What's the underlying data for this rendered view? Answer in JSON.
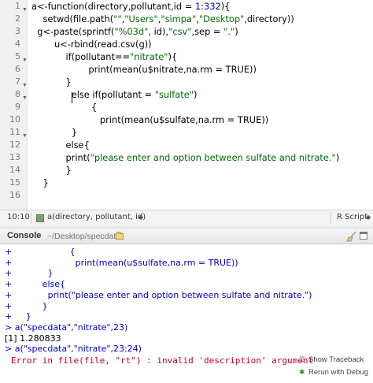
{
  "editor": {
    "line_numbers": [
      "1",
      "2",
      "3",
      "4",
      "5",
      "6",
      "7",
      "8",
      "9",
      "10",
      "11",
      "12",
      "13",
      "14",
      "15",
      "16"
    ],
    "lines": [
      [
        {
          "t": "a<-function(directory,pollutant,id = "
        },
        {
          "t": "1",
          "c": "num"
        },
        {
          "t": ":"
        },
        {
          "t": "332",
          "c": "num"
        },
        {
          "t": "){"
        }
      ],
      [
        {
          "t": "    setwd(file.path("
        },
        {
          "t": "\"\"",
          "c": "str"
        },
        {
          "t": ","
        },
        {
          "t": "\"Users\"",
          "c": "str"
        },
        {
          "t": ","
        },
        {
          "t": "\"simpa\"",
          "c": "str"
        },
        {
          "t": ","
        },
        {
          "t": "\"Desktop\"",
          "c": "str"
        },
        {
          "t": ",directory))"
        }
      ],
      [
        {
          "t": "  g<-paste(sprintf("
        },
        {
          "t": "\"%03d\"",
          "c": "str"
        },
        {
          "t": ", id),"
        },
        {
          "t": "\"csv\"",
          "c": "str"
        },
        {
          "t": ",sep = "
        },
        {
          "t": "\".\"",
          "c": "str"
        },
        {
          "t": ")"
        }
      ],
      [
        {
          "t": "        u<-rbind(read.csv(g))"
        }
      ],
      [
        {
          "t": "            if(pollutant=="
        },
        {
          "t": "\"nitrate\"",
          "c": "str"
        },
        {
          "t": "){"
        }
      ],
      [
        {
          "t": "                    print(mean(u$nitrate,na.rm = TRUE))"
        }
      ],
      [
        {
          "t": "            }"
        }
      ],
      [
        {
          "t": "              else if(pollutant = "
        },
        {
          "t": "\"sulfate\"",
          "c": "str"
        },
        {
          "t": ")"
        }
      ],
      [
        {
          "t": "                     {"
        }
      ],
      [
        {
          "t": "                        print(mean(u$sulfate,na.rm = TRUE))"
        }
      ],
      [
        {
          "t": "              }"
        }
      ],
      [
        {
          "t": "            else{"
        }
      ],
      [
        {
          "t": "            print("
        },
        {
          "t": "\"please enter and option between sulfate and nitrate.\"",
          "c": "str"
        },
        {
          "t": ")"
        }
      ],
      [
        {
          "t": "            }"
        }
      ],
      [
        {
          "t": "    }"
        }
      ],
      [
        {
          "t": ""
        }
      ]
    ]
  },
  "statusbar": {
    "position": "10:10",
    "function_name": "a(directory, pollutant, id)",
    "language": "R Script"
  },
  "console": {
    "title": "Console",
    "path": "~/Desktop/specdata/",
    "lines": [
      {
        "t": "+                     {"
      },
      {
        "t": "+                       print(mean(u$sulfate,na.rm = TRUE))"
      },
      {
        "t": "+             }"
      },
      {
        "t": "+           else{"
      },
      {
        "t": "+             print(\"please enter and option between sulfate and nitrate.\")"
      },
      {
        "t": "+           }"
      },
      {
        "t": "+     }"
      },
      {
        "t": "> a(\"specdata\",\"nitrate\",23)"
      },
      {
        "t": "[1] 1.280833",
        "c": "out"
      },
      {
        "t": "> a(\"specdata\",\"nitrate\",23:24)"
      }
    ],
    "error_text": "Error in file(file, \"rt\") : invalid 'description' argument",
    "show_traceback_label": "Show Traceback",
    "rerun_debug_label": "Rerun with Debug"
  },
  "colors": {
    "string": "#036a07",
    "number": "#0000cd",
    "console_input": "#0000cc",
    "error": "#c4001c"
  }
}
